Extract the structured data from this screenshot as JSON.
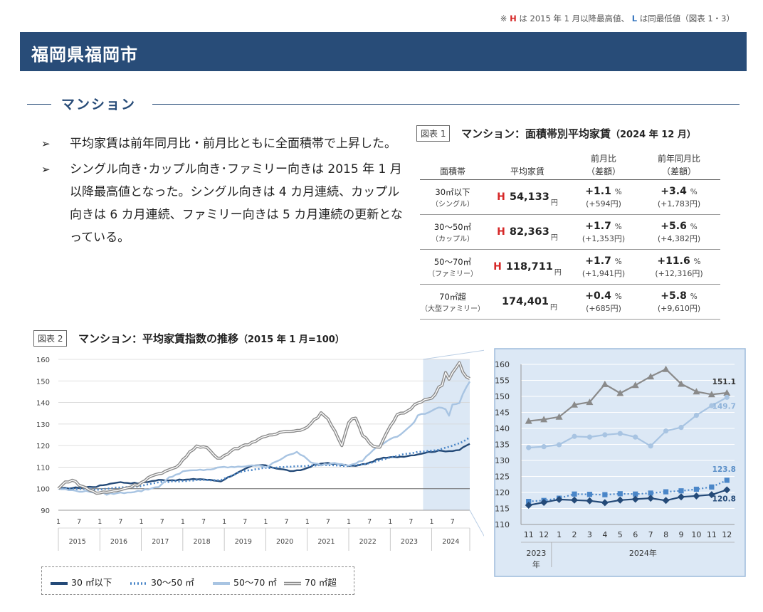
{
  "top_note": {
    "prefix": "※",
    "h": "H",
    "mid": "は 2015 年 1 月以降最高値、",
    "l": "L",
    "suffix": "は同最低値（図表 1・3）"
  },
  "city": "福岡県福岡市",
  "section_title": "マンション",
  "bullets": [
    "平均家賃は前年同月比・前月比ともに全面積帯で上昇した。",
    "シングル向き･カップル向き･ファミリー向きは 2015 年 1 月以降最高値となった。シングル向きは 4 カ月連続、カップル向きは 6 カ月連続、ファミリー向きは 5 カ月連続の更新となっている。"
  ],
  "bullet_marker": "➢",
  "fig1": {
    "label": "図表 1",
    "title": "マンション：面積帯別平均家賃",
    "title_sub": "（2024 年 12 月）",
    "headers": {
      "band": "面積帯",
      "rent": "平均家賃",
      "mom": "前月比",
      "mom_sub": "（差額）",
      "yoy": "前年同月比",
      "yoy_sub": "（差額）"
    },
    "yen_unit": "円",
    "pct_unit": "%",
    "rows": [
      {
        "band": "30㎡以下",
        "sub": "（シングル）",
        "h": "H",
        "rent": "54,133",
        "mom": "+1.1",
        "mom_diff": "(+594円)",
        "yoy": "+3.4",
        "yoy_diff": "(+1,783円)"
      },
      {
        "band": "30～50㎡",
        "sub": "（カップル）",
        "h": "H",
        "rent": "82,363",
        "mom": "+1.7",
        "mom_diff": "(+1,353円)",
        "yoy": "+5.6",
        "yoy_diff": "(+4,382円)"
      },
      {
        "band": "50～70㎡",
        "sub": "（ファミリー）",
        "h": "H",
        "rent": "118,711",
        "mom": "+1.7",
        "mom_diff": "(+1,941円)",
        "yoy": "+11.6",
        "yoy_diff": "(+12,316円)"
      },
      {
        "band": "70㎡超",
        "sub": "（大型ファミリー）",
        "h": "",
        "rent": "174,401",
        "mom": "+0.4",
        "mom_diff": "(+685円)",
        "yoy": "+5.8",
        "yoy_diff": "(+9,610円)"
      }
    ]
  },
  "fig2": {
    "label": "図表 2",
    "title": "マンション：平均家賃指数の推移",
    "title_sub": "（2015 年 1 月=100）"
  },
  "chart_data": [
    {
      "type": "line",
      "ylim": [
        90,
        160
      ],
      "yticks": [
        90,
        100,
        110,
        120,
        130,
        140,
        150,
        160
      ],
      "x_month_labels": [
        "1",
        "7"
      ],
      "years": [
        "2015",
        "2016",
        "2017",
        "2018",
        "2019",
        "2020",
        "2021",
        "2022",
        "2023",
        "2024"
      ],
      "grid": true,
      "series": [
        {
          "name": "30 ㎡以下",
          "color": "#244a78",
          "style": "solid",
          "anchors": [
            [
              0,
              100
            ],
            [
              6,
              100.5
            ],
            [
              11,
              101
            ],
            [
              17,
              103
            ],
            [
              23,
              102.5
            ],
            [
              29,
              104
            ],
            [
              35,
              104
            ],
            [
              41,
              104.5
            ],
            [
              47,
              103.5
            ],
            [
              50,
              106
            ],
            [
              56,
              110.5
            ],
            [
              59,
              111
            ],
            [
              63,
              109.5
            ],
            [
              68,
              108
            ],
            [
              71,
              109
            ],
            [
              74,
              111
            ],
            [
              78,
              112
            ],
            [
              82,
              111
            ],
            [
              86,
              110.5
            ],
            [
              90,
              112
            ],
            [
              93,
              114
            ],
            [
              96,
              114.5
            ],
            [
              100,
              115
            ],
            [
              104,
              116
            ],
            [
              107,
              117
            ],
            [
              110,
              117.5
            ],
            [
              113,
              117.5
            ],
            [
              116,
              118
            ],
            [
              119,
              120.8
            ]
          ],
          "noise": 0.5
        },
        {
          "name": "30～50 ㎡",
          "color": "#4a86c8",
          "style": "dotted",
          "anchors": [
            [
              0,
              100
            ],
            [
              6,
              100
            ],
            [
              11,
              99.5
            ],
            [
              17,
              100.5
            ],
            [
              23,
              101
            ],
            [
              29,
              103
            ],
            [
              35,
              103.5
            ],
            [
              41,
              104
            ],
            [
              47,
              104
            ],
            [
              53,
              108
            ],
            [
              59,
              109.5
            ],
            [
              65,
              110
            ],
            [
              71,
              110.5
            ],
            [
              77,
              111
            ],
            [
              83,
              110.5
            ],
            [
              89,
              111.5
            ],
            [
              95,
              114
            ],
            [
              100,
              116
            ],
            [
              104,
              117
            ],
            [
              107,
              117.5
            ],
            [
              110,
              118
            ],
            [
              113,
              119.5
            ],
            [
              116,
              121
            ],
            [
              119,
              123.8
            ]
          ],
          "noise": 0.3
        },
        {
          "name": "50～70 ㎡",
          "color": "#a8c4e2",
          "style": "solid",
          "anchors": [
            [
              0,
              100
            ],
            [
              5,
              99
            ],
            [
              10,
              98.5
            ],
            [
              14,
              97.5
            ],
            [
              18,
              98
            ],
            [
              24,
              99
            ],
            [
              29,
              101
            ],
            [
              32,
              105
            ],
            [
              36,
              108
            ],
            [
              40,
              108.5
            ],
            [
              44,
              109
            ],
            [
              48,
              110
            ],
            [
              52,
              110
            ],
            [
              56,
              111
            ],
            [
              60,
              110
            ],
            [
              62,
              112
            ],
            [
              66,
              115
            ],
            [
              69,
              117
            ],
            [
              71,
              115
            ],
            [
              73,
              112
            ],
            [
              76,
              111
            ],
            [
              80,
              112
            ],
            [
              84,
              111
            ],
            [
              88,
              113
            ],
            [
              91,
              118
            ],
            [
              95,
              122
            ],
            [
              99,
              125
            ],
            [
              103,
              131
            ],
            [
              104,
              134
            ],
            [
              105,
              134.5
            ],
            [
              107,
              135
            ],
            [
              110,
              138
            ],
            [
              112,
              137
            ],
            [
              113,
              134
            ],
            [
              114,
              139
            ],
            [
              116,
              140
            ],
            [
              117,
              144
            ],
            [
              118,
              147
            ],
            [
              119,
              149.7
            ]
          ],
          "noise": 0.7
        },
        {
          "name": "70 ㎡超",
          "color": "#8a8a8a",
          "style": "double",
          "anchors": [
            [
              0,
              100
            ],
            [
              2,
              103
            ],
            [
              4,
              104
            ],
            [
              7,
              101
            ],
            [
              11,
              98
            ],
            [
              15,
              98.5
            ],
            [
              19,
              100
            ],
            [
              23,
              102
            ],
            [
              27,
              106
            ],
            [
              30,
              107
            ],
            [
              34,
              110
            ],
            [
              37,
              115
            ],
            [
              40,
              120
            ],
            [
              43,
              119
            ],
            [
              46,
              114
            ],
            [
              48,
              115
            ],
            [
              50,
              118
            ],
            [
              54,
              120
            ],
            [
              58,
              123
            ],
            [
              62,
              125
            ],
            [
              66,
              127
            ],
            [
              70,
              127
            ],
            [
              73,
              130
            ],
            [
              76,
              135
            ],
            [
              78,
              132
            ],
            [
              80,
              127
            ],
            [
              82,
              120
            ],
            [
              84,
              131
            ],
            [
              86,
              133
            ],
            [
              88,
              125
            ],
            [
              91,
              120
            ],
            [
              93,
              119
            ],
            [
              95,
              126
            ],
            [
              98,
              134
            ],
            [
              101,
              136
            ],
            [
              104,
              140
            ],
            [
              107,
              142
            ],
            [
              108,
              142.5
            ],
            [
              109,
              143.5
            ],
            [
              110,
              147
            ],
            [
              111,
              148
            ],
            [
              112,
              153.5
            ],
            [
              113,
              151
            ],
            [
              114,
              153.5
            ],
            [
              115,
              156
            ],
            [
              116,
              158.5
            ],
            [
              117,
              154
            ],
            [
              118,
              151.5
            ],
            [
              119,
              151.1
            ]
          ],
          "noise": 0.9
        }
      ]
    },
    {
      "type": "line",
      "ylim": [
        110,
        160
      ],
      "yticks": [
        110,
        115,
        120,
        125,
        130,
        135,
        140,
        145,
        150,
        155,
        160
      ],
      "categories": [
        "11",
        "12",
        "1",
        "2",
        "3",
        "4",
        "5",
        "6",
        "7",
        "8",
        "9",
        "10",
        "11",
        "12"
      ],
      "year_labels": [
        "2023",
        "年",
        "2024年"
      ],
      "grid": true,
      "series": [
        {
          "name": "70 ㎡超",
          "color": "#8a8a8a",
          "marker": "triangle",
          "values": [
            142.3,
            142.8,
            143.6,
            147.4,
            148.2,
            153.8,
            151.0,
            153.5,
            156.2,
            158.5,
            153.9,
            151.5,
            150.6,
            151.1
          ]
        },
        {
          "name": "50～70 ㎡",
          "color": "#a8c4e2",
          "marker": "circle",
          "values": [
            134.0,
            134.3,
            134.9,
            137.5,
            137.3,
            138.0,
            138.4,
            137.3,
            134.5,
            139.2,
            140.3,
            144.1,
            147.1,
            149.7
          ]
        },
        {
          "name": "30～50 ㎡",
          "color": "#4a86c8",
          "marker": "square",
          "dash": true,
          "values": [
            117.2,
            117.5,
            118.2,
            119.5,
            119.4,
            119.3,
            119.6,
            119.5,
            119.8,
            120.2,
            120.5,
            121.0,
            121.7,
            123.8
          ]
        },
        {
          "name": "30 ㎡以下",
          "color": "#244a78",
          "marker": "diamond",
          "values": [
            116.0,
            116.9,
            117.8,
            117.6,
            117.4,
            116.8,
            117.6,
            117.9,
            118.2,
            117.5,
            118.6,
            118.9,
            119.3,
            120.8
          ]
        }
      ],
      "end_labels": [
        "151.1",
        "149.7",
        "123.8",
        "120.8"
      ]
    }
  ],
  "legend": [
    "30 ㎡以下",
    "30～50 ㎡",
    "50～70 ㎡",
    "70 ㎡超"
  ]
}
